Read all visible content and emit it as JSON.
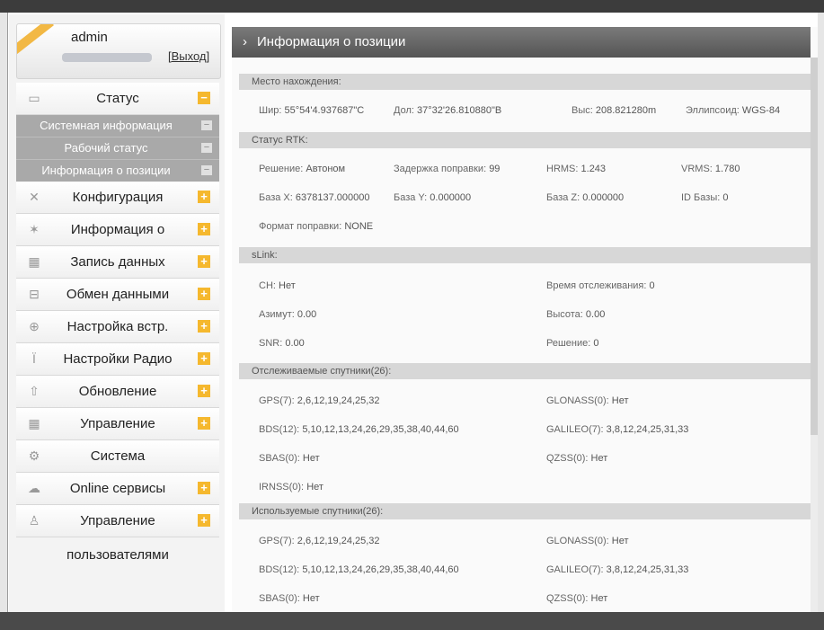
{
  "user": {
    "name": "admin",
    "logout": "[Выход]"
  },
  "nav": {
    "status": "Статус",
    "sub": [
      "Системная информация",
      "Рабочий статус",
      "Информация о позиции"
    ],
    "items": [
      "Конфигурация",
      "Информация о",
      "Запись данных",
      "Обмен данными",
      "Настройка встр.",
      "Настройки Радио",
      "Обновление",
      "Управление",
      "Система",
      "Online сервисы",
      "Управление"
    ],
    "tail": "пользователями",
    "icons": [
      "monitor-icon",
      "tools-icon",
      "satellite-icon",
      "calendar-icon",
      "network-icon",
      "settings-icon",
      "antenna-icon",
      "upload-icon",
      "calendar-icon",
      "gear-icon",
      "cloud-icon",
      "users-icon"
    ]
  },
  "page_title": "Информация о позиции",
  "sections": {
    "position": "Место нахождения:",
    "rtk": "Статус RTK:",
    "slink": "sLink:",
    "tracked": "Отслеживаемые спутники(26):",
    "used": "Используемые спутники(26):"
  },
  "position": {
    "lat_k": "Шир:",
    "lat_v": "55°54'4.937687\"С",
    "lon_k": "Дол:",
    "lon_v": "37°32'26.810880\"В",
    "alt_k": "Выс:",
    "alt_v": "208.821280m",
    "ell_k": "Эллипсоид:",
    "ell_v": "WGS-84"
  },
  "rtk": {
    "sol_k": "Решение:",
    "sol_v": "Автоном",
    "delay_k": "Задержка поправки:",
    "delay_v": "99",
    "hrms_k": "HRMS:",
    "hrms_v": "1.243",
    "vrms_k": "VRMS:",
    "vrms_v": "1.780",
    "bx_k": "База X:",
    "bx_v": "6378137.000000",
    "by_k": "База Y:",
    "by_v": "0.000000",
    "bz_k": "База Z:",
    "bz_v": "0.000000",
    "id_k": "ID Базы:",
    "id_v": "0",
    "fmt_k": "Формат поправки:",
    "fmt_v": "NONE"
  },
  "slink": {
    "ch_k": "CH:",
    "ch_v": "Нет",
    "time_k": "Время отслеживания:",
    "time_v": "0",
    "az_k": "Азимут:",
    "az_v": "0.00",
    "h_k": "Высота:",
    "h_v": "0.00",
    "snr_k": "SNR:",
    "snr_v": "0.00",
    "sol_k": "Решение:",
    "sol_v": "0"
  },
  "tracked": {
    "gps_k": "GPS(7):",
    "gps_v": "2,6,12,19,24,25,32",
    "glo_k": "GLONASS(0):",
    "glo_v": "Нет",
    "bds_k": "BDS(12):",
    "bds_v": "5,10,12,13,24,26,29,35,38,40,44,60",
    "gal_k": "GALILEO(7):",
    "gal_v": "3,8,12,24,25,31,33",
    "sbas_k": "SBAS(0):",
    "sbas_v": "Нет",
    "qzss_k": "QZSS(0):",
    "qzss_v": "Нет",
    "irnss_k": "IRNSS(0):",
    "irnss_v": "Нет"
  },
  "used": {
    "gps_k": "GPS(7):",
    "gps_v": "2,6,12,19,24,25,32",
    "glo_k": "GLONASS(0):",
    "glo_v": "Нет",
    "bds_k": "BDS(12):",
    "bds_v": "5,10,12,13,24,26,29,35,38,40,44,60",
    "gal_k": "GALILEO(7):",
    "gal_v": "3,8,12,24,25,31,33",
    "sbas_k": "SBAS(0):",
    "sbas_v": "Нет",
    "qzss_k": "QZSS(0):",
    "qzss_v": "Нет"
  }
}
